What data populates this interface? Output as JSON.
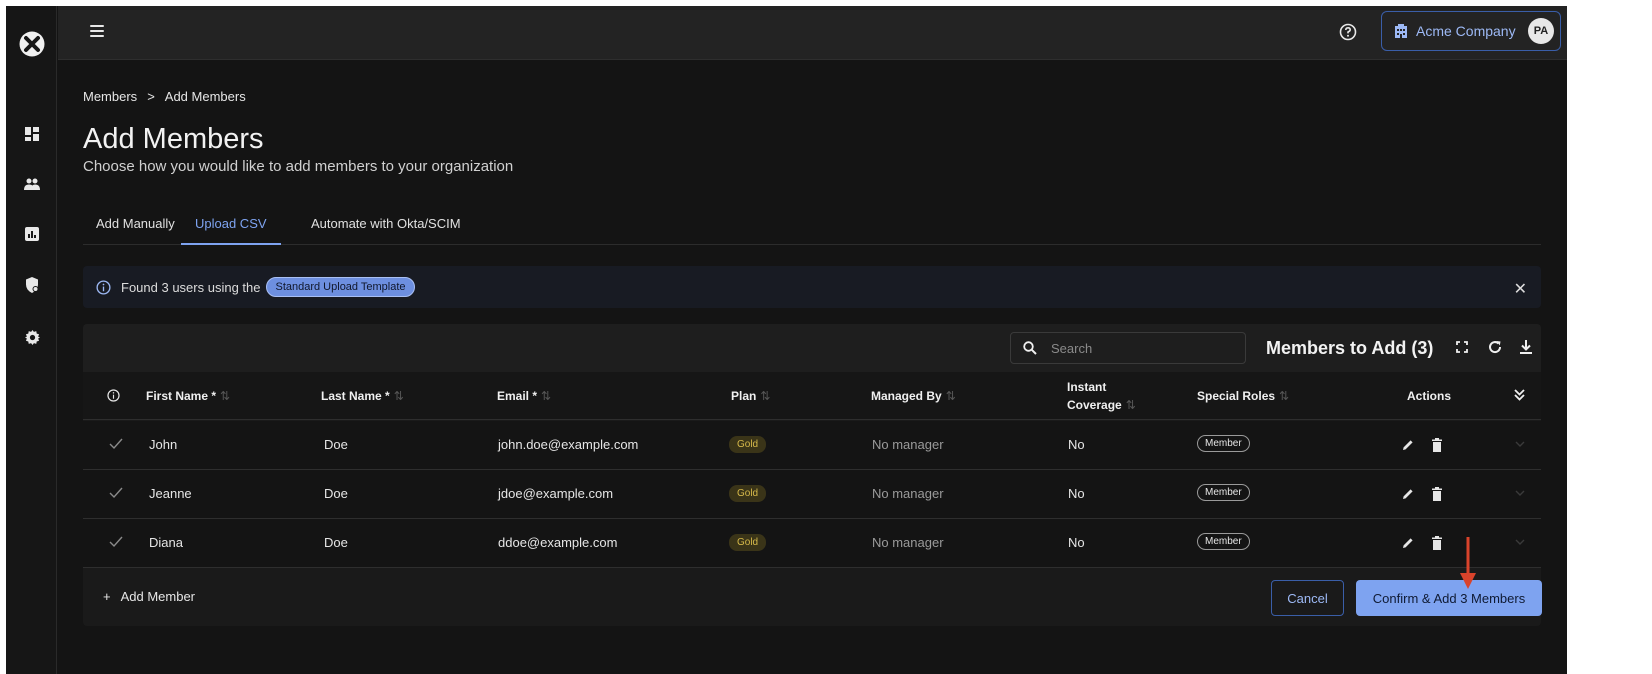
{
  "topbar": {
    "company_name": "Acme Company",
    "avatar_initials": "PA"
  },
  "breadcrumb": {
    "items": [
      "Members",
      "Add Members"
    ],
    "separator": ">"
  },
  "page": {
    "title": "Add Members",
    "subtitle": "Choose how you would like to add members to your organization"
  },
  "tabs": [
    {
      "label": "Add Manually",
      "active": false
    },
    {
      "label": "Upload CSV",
      "active": true
    },
    {
      "label": "Automate with Okta/SCIM",
      "active": false
    }
  ],
  "banner": {
    "text": "Found 3 users using the",
    "template_chip": "Standard Upload Template"
  },
  "table": {
    "search_placeholder": "Search",
    "title": "Members to Add (3)",
    "columns": {
      "first_name": "First Name *",
      "last_name": "Last Name *",
      "email": "Email *",
      "plan": "Plan",
      "managed_by": "Managed By",
      "instant_coverage_1": "Instant",
      "instant_coverage_2": "Coverage",
      "special_roles": "Special Roles",
      "actions": "Actions"
    },
    "rows": [
      {
        "first": "John",
        "last": "Doe",
        "email": "john.doe@example.com",
        "plan": "Gold",
        "manager": "No manager",
        "coverage": "No",
        "role": "Member"
      },
      {
        "first": "Jeanne",
        "last": "Doe",
        "email": "jdoe@example.com",
        "plan": "Gold",
        "manager": "No manager",
        "coverage": "No",
        "role": "Member"
      },
      {
        "first": "Diana",
        "last": "Doe",
        "email": "ddoe@example.com",
        "plan": "Gold",
        "manager": "No manager",
        "coverage": "No",
        "role": "Member"
      }
    ],
    "add_member_label": "Add Member"
  },
  "buttons": {
    "cancel": "Cancel",
    "confirm": "Confirm & Add 3 Members"
  },
  "colors": {
    "accent": "#7ea3f0",
    "background": "#141414",
    "annotation_arrow": "#d9432b",
    "gold_badge": "#d6b94a"
  }
}
